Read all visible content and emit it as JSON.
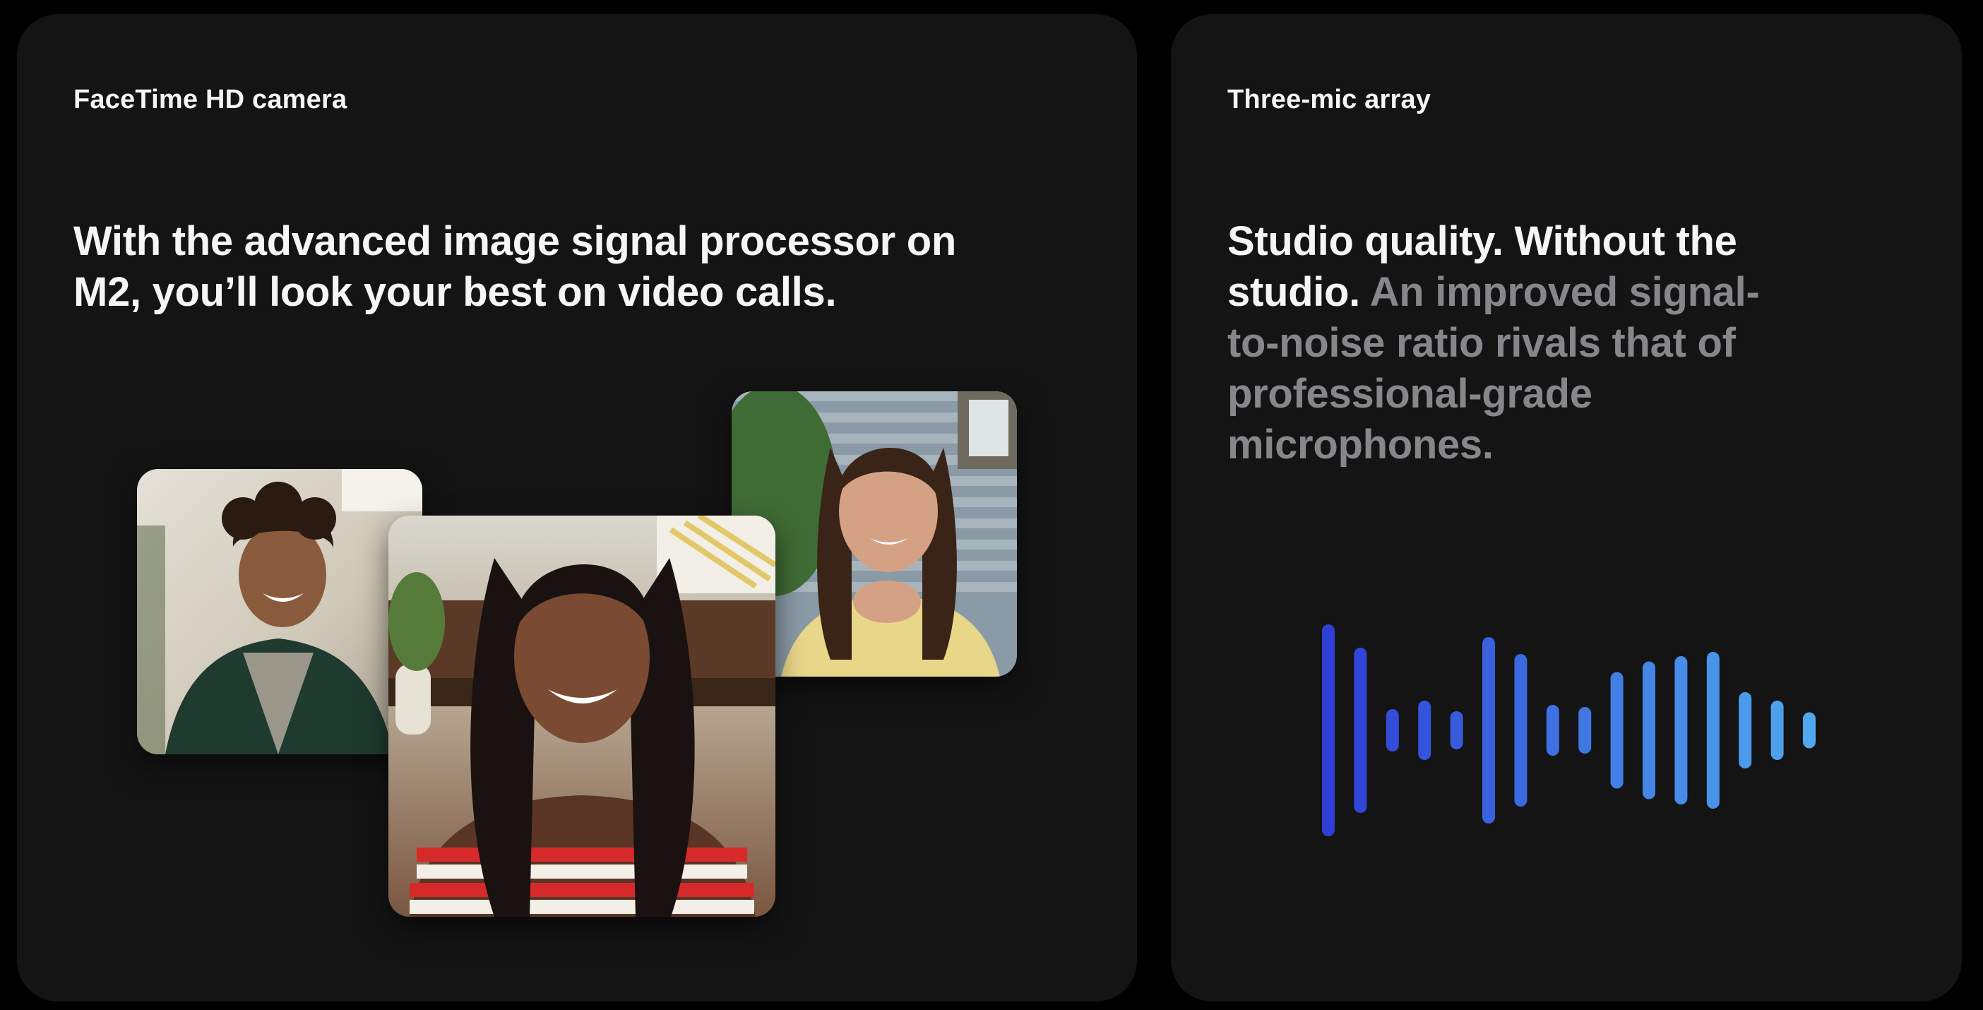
{
  "camera_card": {
    "eyebrow": "FaceTime HD camera",
    "headline": "With the advanced image signal processor on M2, you’ll look your best on video calls."
  },
  "mic_card": {
    "eyebrow": "Three-mic array",
    "headline_strong": "Studio quality. Without the studio.",
    "headline_muted": "An improved signal-to-noise ratio rivals that of professional-grade microphones."
  },
  "video_tiles": [
    {
      "name": "participant-left-video",
      "icon": "person-video"
    },
    {
      "name": "participant-center-video",
      "icon": "person-video"
    },
    {
      "name": "participant-right-video",
      "icon": "person-video"
    }
  ],
  "waveform": {
    "icon": "audio-waveform-icon",
    "levels": [
      1.0,
      0.78,
      0.2,
      0.28,
      0.18,
      0.88,
      0.72,
      0.24,
      0.22,
      0.55,
      0.65,
      0.7,
      0.74,
      0.36,
      0.28,
      0.17
    ],
    "colors": [
      "#2f3fd6",
      "#4fa8ee"
    ]
  },
  "colors": {
    "page_bg": "#000000",
    "card_bg": "#141414",
    "text_primary": "#f5f5f7",
    "text_muted": "#86868b"
  }
}
